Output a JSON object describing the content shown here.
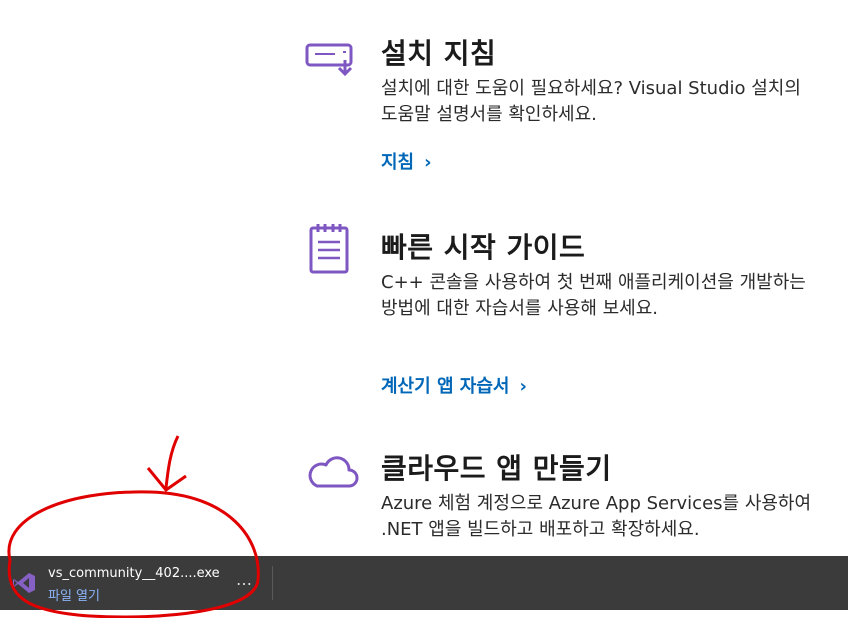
{
  "cards": [
    {
      "title": "설치 지침",
      "text": "설치에 대한 도움이 필요하세요? Visual Studio 설치의 도움말 설명서를 확인하세요.",
      "link": "지침",
      "icon": "monitor-download-icon"
    },
    {
      "title": "빠른 시작 가이드",
      "text": "C++ 콘솔을 사용하여 첫 번째 애플리케이션을 개발하는 방법에 대한 자습서를 사용해 보세요.",
      "link": "계산기 앱 자습서",
      "icon": "notepad-icon"
    },
    {
      "title": "클라우드 앱 만들기",
      "text": "Azure 체험 계정으로 Azure App Services를 사용하여 .NET 앱을 빌드하고 배포하고 확장하세요.",
      "icon": "cloud-icon"
    }
  ],
  "link_chevron": "›",
  "download_bar": {
    "filename": "vs_community__402....exe",
    "open_label": "파일 열기",
    "more": "…",
    "icon": "visual-studio-icon"
  },
  "colors": {
    "accent": "#0067b8",
    "icon_purple": "#7e57c2",
    "bar_bg": "#3b3b3b",
    "annotation_red": "#e00000"
  }
}
